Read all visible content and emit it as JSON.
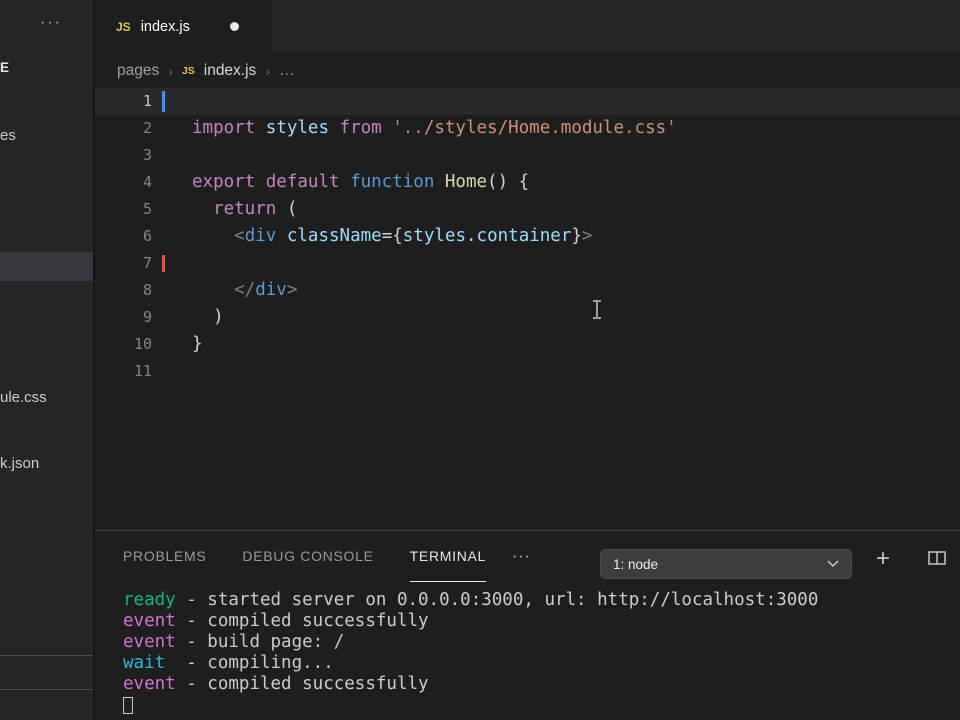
{
  "colors": {
    "kw": "#C586C0",
    "decl": "#569CD6",
    "fn": "#DCDCAA",
    "var": "#9CDCFE",
    "str": "#CE9178",
    "tag": "#569CD6",
    "punct": "#808080",
    "plain": "#D4D4D4",
    "green": "#0DBC79",
    "magenta": "#D670D6",
    "cyan": "#29B8DB",
    "fg": "#CCCCCC"
  },
  "sidebar": {
    "more_icon": "···",
    "partials": [
      "E",
      "es",
      "ule.css",
      "k.json"
    ]
  },
  "tabbar": {
    "tab": {
      "icon": "JS",
      "label": "index.js"
    }
  },
  "breadcrumb": {
    "separator": "›",
    "folder": "pages",
    "file_icon": "JS",
    "file": "index.js",
    "tail": "…"
  },
  "editor": {
    "lines": [
      {
        "num": "1",
        "current": true,
        "cursor": true,
        "tokens": []
      },
      {
        "num": "2",
        "tokens": [
          [
            "import ",
            "kw"
          ],
          [
            "styles ",
            "var"
          ],
          [
            "from ",
            "kw"
          ],
          [
            "'../styles/Home.module.css'",
            "str"
          ]
        ]
      },
      {
        "num": "3",
        "tokens": []
      },
      {
        "num": "4",
        "tokens": [
          [
            "export ",
            "kw"
          ],
          [
            "default ",
            "kw"
          ],
          [
            "function ",
            "decl"
          ],
          [
            "Home",
            "fn"
          ],
          [
            "() {",
            "plain"
          ]
        ]
      },
      {
        "num": "5",
        "tokens": [
          [
            "  ",
            "plain"
          ],
          [
            "return",
            "kw"
          ],
          [
            " (",
            "plain"
          ]
        ]
      },
      {
        "num": "6",
        "tokens": [
          [
            "    ",
            "plain"
          ],
          [
            "<",
            "punct"
          ],
          [
            "div",
            "tag"
          ],
          [
            " ",
            "plain"
          ],
          [
            "className",
            "var"
          ],
          [
            "=",
            "plain"
          ],
          [
            "{",
            "plain"
          ],
          [
            "styles",
            "var"
          ],
          [
            ".",
            "plain"
          ],
          [
            "container",
            "var"
          ],
          [
            "}",
            "plain"
          ],
          [
            ">",
            "punct"
          ]
        ]
      },
      {
        "num": "7",
        "marker": true,
        "tokens": []
      },
      {
        "num": "8",
        "tokens": [
          [
            "    ",
            "plain"
          ],
          [
            "</",
            "punct"
          ],
          [
            "div",
            "tag"
          ],
          [
            ">",
            "punct"
          ]
        ]
      },
      {
        "num": "9",
        "tokens": [
          [
            "  )",
            "plain"
          ]
        ]
      },
      {
        "num": "10",
        "tokens": [
          [
            "}",
            "plain"
          ]
        ]
      },
      {
        "num": "11",
        "tokens": []
      }
    ]
  },
  "panel": {
    "tabs": [
      {
        "label": "PROBLEMS",
        "active": false
      },
      {
        "label": "DEBUG CONSOLE",
        "active": false
      },
      {
        "label": "TERMINAL",
        "active": true
      }
    ],
    "more_icon": "···",
    "terminal_dropdown": "1: node",
    "terminal_lines": [
      [
        [
          "ready",
          "green"
        ],
        [
          " - started server on 0.0.0.0:3000, url: http://localhost:3000",
          "fg"
        ]
      ],
      [
        [
          "event",
          "magenta"
        ],
        [
          " - compiled successfully",
          "fg"
        ]
      ],
      [
        [
          "event",
          "magenta"
        ],
        [
          " - build page: /",
          "fg"
        ]
      ],
      [
        [
          "wait",
          "cyan"
        ],
        [
          "  - compiling...",
          "fg"
        ]
      ],
      [
        [
          "event",
          "magenta"
        ],
        [
          " - compiled successfully",
          "fg"
        ]
      ]
    ]
  }
}
